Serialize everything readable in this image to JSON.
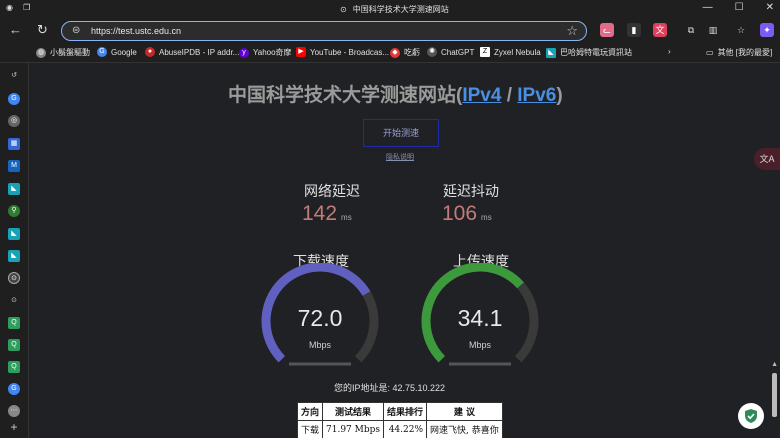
{
  "window": {
    "title": "中国科学技术大学测速网站",
    "controls": {
      "minimize": "—",
      "maximize": "☐",
      "close": "✕"
    }
  },
  "toolbar": {
    "url": "https://test.ustc.edu.cn",
    "back": "←",
    "reload": "↻",
    "star": "☆"
  },
  "bookmarks": [
    {
      "label": "小鬍盤驅動",
      "icon": "globe-icon",
      "color": "#888888"
    },
    {
      "label": "Google",
      "icon": "google-icon",
      "color": "#4285f4"
    },
    {
      "label": "AbuseIPDB - IP addr...",
      "icon": "abuseipdb-icon",
      "color": "#c62828"
    },
    {
      "label": "Yahoo奇摩",
      "icon": "yahoo-icon",
      "color": "#6001d2"
    },
    {
      "label": "YouTube - Broadcas...",
      "icon": "youtube-icon",
      "color": "#ff0000"
    },
    {
      "label": "吃虧",
      "icon": "site-icon",
      "color": "#e53935"
    },
    {
      "label": "ChatGPT",
      "icon": "chatgpt-icon",
      "color": "#888888"
    },
    {
      "label": "Zyxel Nebula",
      "icon": "zyxel-icon",
      "color": "#ffffff"
    },
    {
      "label": "巴哈姆特電玩資訊站",
      "icon": "bahamut-icon",
      "color": "#17a2b8"
    }
  ],
  "bookmarks_other": "其他 [我的最愛]",
  "page": {
    "heading_prefix": "中国科学技术大学测速网站(",
    "ipv4": "IPv4",
    "separator": " / ",
    "ipv6": "IPv6",
    "heading_suffix": ")",
    "start_button": "开始测速",
    "privacy_link": "隐私说明",
    "ping": {
      "label": "网络延迟",
      "value": "142",
      "unit": "ms"
    },
    "jitter": {
      "label": "延迟抖动",
      "value": "106",
      "unit": "ms"
    },
    "download": {
      "label": "下载速度",
      "value": "72.0",
      "unit": "Mbps",
      "level": 0.72,
      "color": "#6060c0"
    },
    "upload": {
      "label": "上传速度",
      "value": "34.1",
      "unit": "Mbps",
      "level": 0.68,
      "color": "#3c9a3c"
    },
    "ip_text": "您的IP地址是: 42.75.10.222",
    "table": {
      "headers": [
        "方向",
        "测试结果",
        "结果排行",
        "建 议"
      ],
      "rows": [
        [
          "下载",
          "71.97 Mbps",
          "44.22%",
          "网速飞快, 恭喜你"
        ]
      ]
    }
  },
  "colors": {
    "accent_link": "#4a90e2",
    "metric_value": "#c47a7a"
  }
}
